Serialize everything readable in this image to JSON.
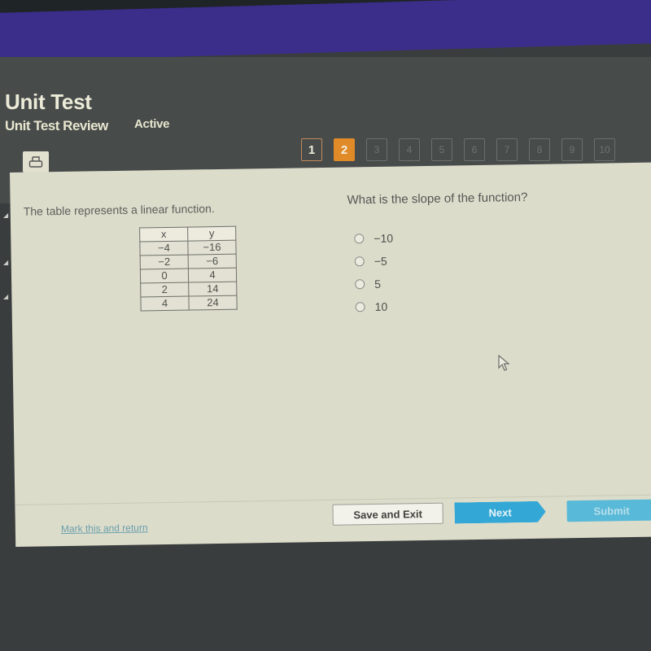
{
  "header": {
    "title": "Unit Test",
    "subtitle": "Unit Test Review",
    "status": "Active",
    "print_icon": "printer-icon"
  },
  "question_nav": {
    "items": [
      {
        "label": "1",
        "state": "visited"
      },
      {
        "label": "2",
        "state": "current"
      },
      {
        "label": "3",
        "state": "unvisited"
      },
      {
        "label": "4",
        "state": "unvisited"
      },
      {
        "label": "5",
        "state": "unvisited"
      },
      {
        "label": "6",
        "state": "unvisited"
      },
      {
        "label": "7",
        "state": "unvisited"
      },
      {
        "label": "8",
        "state": "unvisited"
      },
      {
        "label": "9",
        "state": "unvisited"
      },
      {
        "label": "10",
        "state": "unvisited"
      }
    ],
    "current_color": "#e08a28"
  },
  "prompt": {
    "text": "The table represents a linear function.",
    "table": {
      "headers": [
        "x",
        "y"
      ],
      "rows": [
        [
          "−4",
          "−16"
        ],
        [
          "−2",
          "−6"
        ],
        [
          "0",
          "4"
        ],
        [
          "2",
          "14"
        ],
        [
          "4",
          "24"
        ]
      ]
    }
  },
  "question": {
    "text": "What is the slope of the function?",
    "options": [
      {
        "label": "−10",
        "selected": false
      },
      {
        "label": "−5",
        "selected": false
      },
      {
        "label": "5",
        "selected": false
      },
      {
        "label": "10",
        "selected": false
      }
    ]
  },
  "footer": {
    "mark_link": "Mark this and return",
    "save_label": "Save and Exit",
    "next_label": "Next",
    "submit_label": "Submit",
    "next_color": "#33a8d6"
  }
}
